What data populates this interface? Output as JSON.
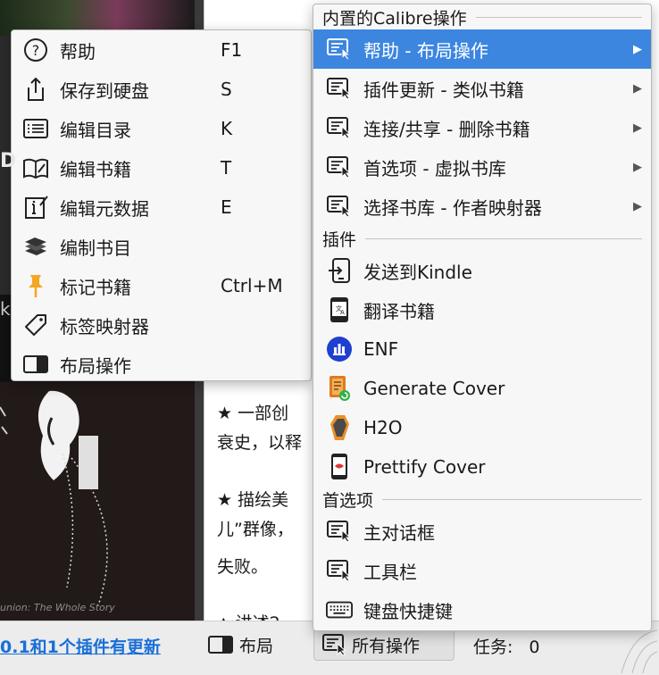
{
  "background": {
    "cover_caption": "union: The Whole Story",
    "cover_letter_1": "k",
    "cover_letter_2": "D",
    "text_lines": [
      "★ 一部创",
      "衰史，以释",
      "★ 描绘美",
      "儿”群像，",
      "失败。",
      "▲ 讲述2"
    ]
  },
  "statusbar": {
    "update_link": "0.1和1个插件有更新",
    "layout_label": "布局",
    "all_actions_label": "所有操作",
    "jobs_label": "任务:",
    "jobs_count": "0"
  },
  "left_menu": {
    "items": [
      {
        "label": "帮助",
        "shortcut": "F1",
        "icon": "help-icon"
      },
      {
        "label": "保存到硬盘",
        "shortcut": "S",
        "icon": "save-to-disk-icon"
      },
      {
        "label": "编辑目录",
        "shortcut": "K",
        "icon": "edit-toc-icon"
      },
      {
        "label": "编辑书籍",
        "shortcut": "T",
        "icon": "edit-book-icon"
      },
      {
        "label": "编辑元数据",
        "shortcut": "E",
        "icon": "edit-metadata-icon"
      },
      {
        "label": "编制书目",
        "shortcut": "",
        "icon": "catalog-icon"
      },
      {
        "label": "标记书籍",
        "shortcut": "Ctrl+M",
        "icon": "mark-book-icon"
      },
      {
        "label": "标签映射器",
        "shortcut": "",
        "icon": "tag-mapper-icon"
      },
      {
        "label": "布局操作",
        "shortcut": "",
        "icon": "layout-icon"
      }
    ]
  },
  "right_menu": {
    "section_builtin": "内置的Calibre操作",
    "builtin_items": [
      {
        "label": "帮助 - 布局操作",
        "icon": "action-menu-icon",
        "highlighted": true
      },
      {
        "label": "插件更新 - 类似书籍",
        "icon": "action-menu-icon",
        "highlighted": false
      },
      {
        "label": "连接/共享 - 删除书籍",
        "icon": "action-menu-icon",
        "highlighted": false
      },
      {
        "label": "首选项 - 虚拟书库",
        "icon": "action-menu-icon",
        "highlighted": false
      },
      {
        "label": "选择书库 - 作者映射器",
        "icon": "action-menu-icon",
        "highlighted": false
      }
    ],
    "section_plugins": "插件",
    "plugin_items": [
      {
        "label": "发送到Kindle",
        "icon": "send-to-kindle-icon"
      },
      {
        "label": "翻译书籍",
        "icon": "translate-book-icon"
      },
      {
        "label": "ENF",
        "icon": "enf-icon"
      },
      {
        "label": "Generate Cover",
        "icon": "generate-cover-icon"
      },
      {
        "label": "H2O",
        "icon": "h2o-icon"
      },
      {
        "label": "Prettify Cover",
        "icon": "prettify-cover-icon"
      }
    ],
    "section_prefs": "首选项",
    "pref_items": [
      {
        "label": "主对话框",
        "icon": "action-menu-icon"
      },
      {
        "label": "工具栏",
        "icon": "action-menu-icon"
      },
      {
        "label": "键盘快捷键",
        "icon": "keyboard-icon"
      }
    ]
  },
  "colors": {
    "highlight": "#3c86e0",
    "link": "#1a6fd8",
    "pin_orange": "#f5a623",
    "enf_blue": "#1f3fd1"
  }
}
